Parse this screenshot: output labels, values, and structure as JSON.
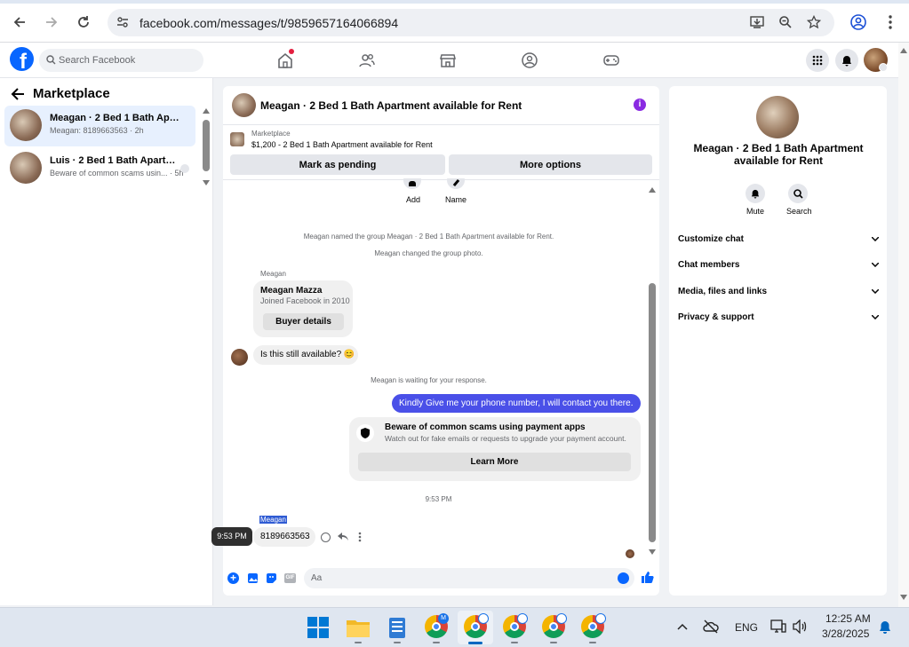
{
  "browser": {
    "url": "facebook.com/messages/t/9859657164066894"
  },
  "header": {
    "search_placeholder": "Search Facebook"
  },
  "sidebar": {
    "title": "Marketplace",
    "conversations": [
      {
        "title": "Meagan · 2 Bed 1 Bath Apartm...",
        "preview": "Meagan: 8189663563 · 2h"
      },
      {
        "title": "Luis · 2 Bed 1 Bath Apartmen...",
        "preview": "Beware of common scams usin... · 5h"
      }
    ]
  },
  "chat": {
    "title": "Meagan · 2 Bed 1 Bath Apartment available for Rent",
    "listing_label": "Marketplace",
    "listing_title": "$1,200 - 2 Bed 1 Bath Apartment available for Rent",
    "mark_pending_label": "Mark as pending",
    "more_options_label": "More options",
    "add_label": "Add",
    "name_label": "Name",
    "sys_named": "Meagan named the group Meagan · 2 Bed 1 Bath Apartment available for Rent.",
    "sys_photo": "Meagan changed the group photo.",
    "sender_label_1": "Meagan",
    "profile_name": "Meagan Mazza",
    "profile_joined": "Joined Facebook in 2010",
    "buyer_details_label": "Buyer details",
    "msg_available": "Is this still available? 😊",
    "sys_waiting": "Meagan is waiting for your response.",
    "msg_out": "Kindly Give me your phone number, I will contact you there.",
    "scam_title": "Beware of common scams using payment apps",
    "scam_desc": "Watch out for fake emails or requests to upgrade your payment account.",
    "learn_more_label": "Learn More",
    "timestamp": "9:53 PM",
    "sender_label_2": "Meagan",
    "msg_phone": "8189663563",
    "tooltip_time": "9:53 PM",
    "composer_placeholder": "Aa"
  },
  "details": {
    "title": "Meagan · 2 Bed 1 Bath Apartment available for Rent",
    "mute_label": "Mute",
    "search_label": "Search",
    "sections": [
      "Customize chat",
      "Chat members",
      "Media, files and links",
      "Privacy & support"
    ]
  },
  "taskbar": {
    "language": "ENG",
    "time": "12:25 AM",
    "date": "3/28/2025",
    "badge_letter": "M"
  },
  "colors": {
    "accent": "#0866ff",
    "outgoing_bubble": "#4a50e8",
    "info_icon": "#8a2be2"
  }
}
